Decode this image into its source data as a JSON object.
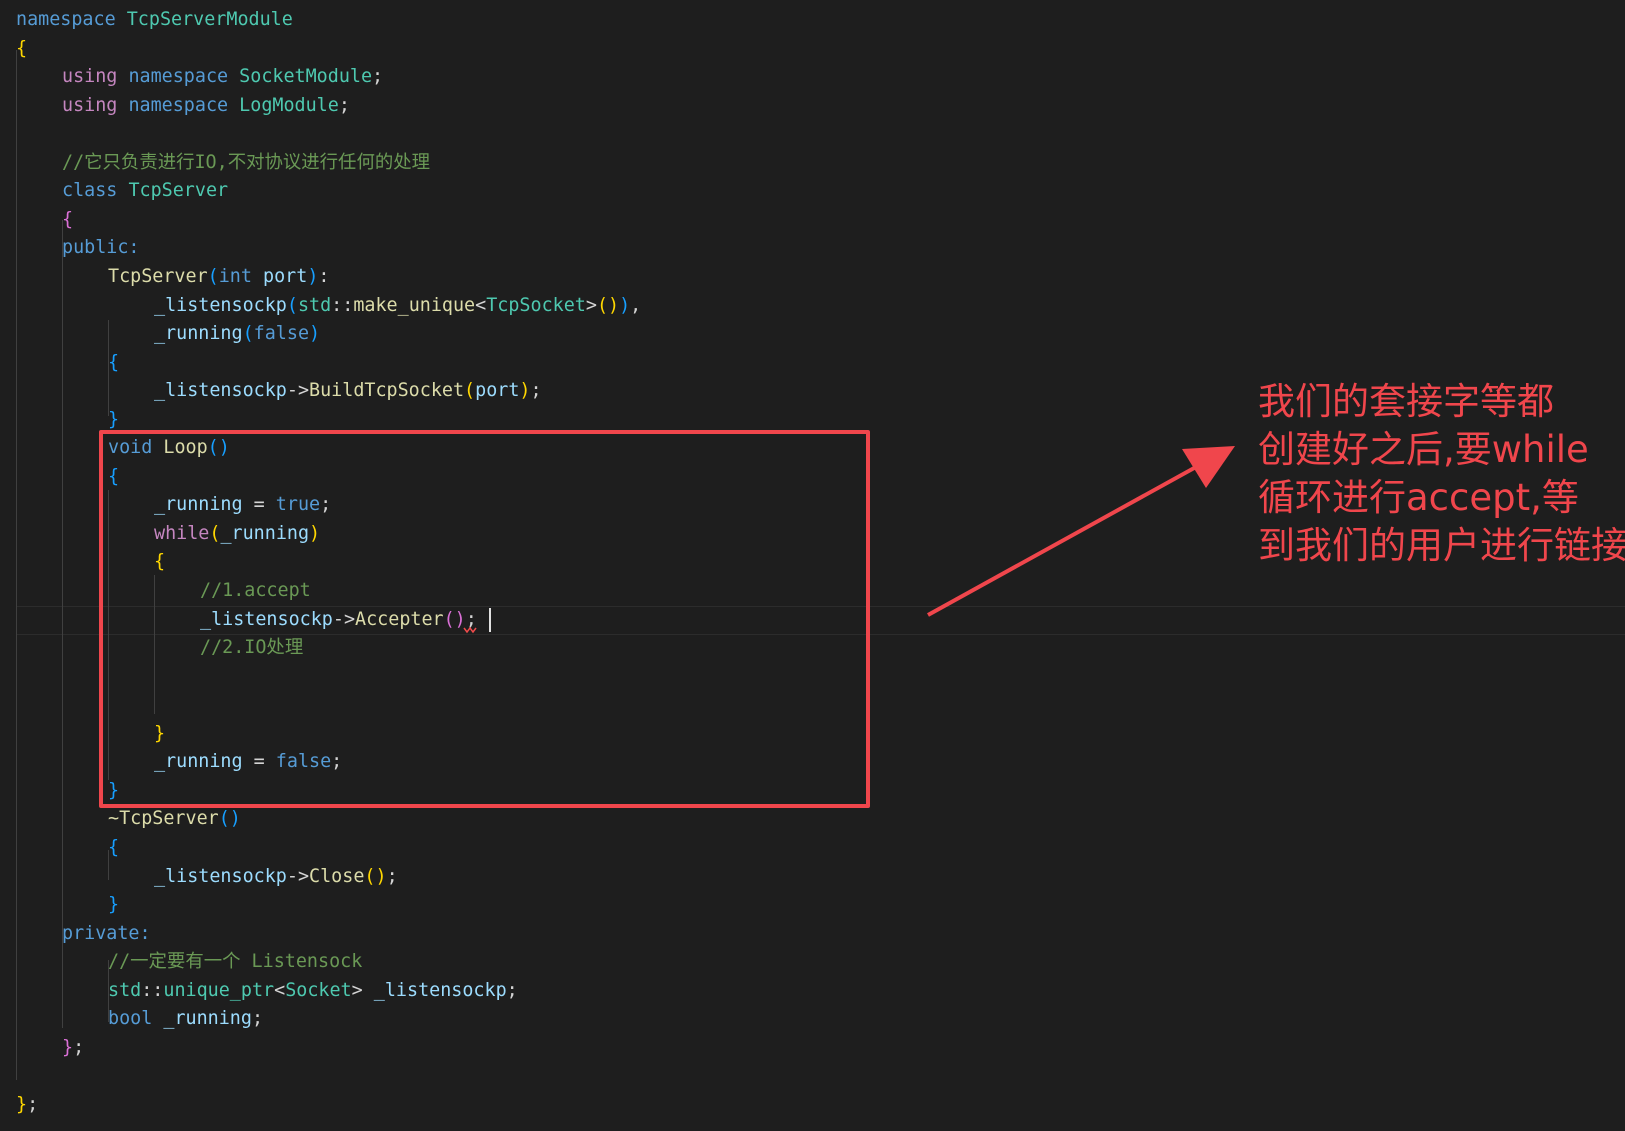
{
  "colors": {
    "background": "#1e1e1e",
    "keyword_blue": "#569cd6",
    "control_pink": "#c586c0",
    "type_teal": "#4ec9b0",
    "function_yellow": "#dcdcaa",
    "variable_lightblue": "#9cdcfe",
    "comment_green": "#6a9955",
    "plain": "#d4d4d4",
    "bracket_gold": "#ffd700",
    "bracket_purple": "#da70d6",
    "bracket_blue": "#179fff",
    "annotation_red": "#f0464c"
  },
  "code_lines": [
    {
      "indent": 0,
      "tokens": [
        [
          "namespace ",
          "#569cd6"
        ],
        [
          "TcpServerModule",
          "#4ec9b0"
        ]
      ]
    },
    {
      "indent": 0,
      "tokens": [
        [
          "{",
          "#ffd700"
        ]
      ]
    },
    {
      "indent": 1,
      "tokens": [
        [
          "using ",
          "#c586c0"
        ],
        [
          "namespace ",
          "#569cd6"
        ],
        [
          "SocketModule",
          "#4ec9b0"
        ],
        [
          ";",
          "#d4d4d4"
        ]
      ]
    },
    {
      "indent": 1,
      "tokens": [
        [
          "using ",
          "#c586c0"
        ],
        [
          "namespace ",
          "#569cd6"
        ],
        [
          "LogModule",
          "#4ec9b0"
        ],
        [
          ";",
          "#d4d4d4"
        ]
      ]
    },
    {
      "indent": 0,
      "tokens": []
    },
    {
      "indent": 1,
      "tokens": [
        [
          "//它只负责进行IO,不对协议进行任何的处理",
          "#6a9955"
        ]
      ]
    },
    {
      "indent": 1,
      "tokens": [
        [
          "class ",
          "#569cd6"
        ],
        [
          "TcpServer",
          "#4ec9b0"
        ]
      ]
    },
    {
      "indent": 1,
      "tokens": [
        [
          "{",
          "#da70d6"
        ]
      ]
    },
    {
      "indent": 1,
      "tokens": [
        [
          "public:",
          "#569cd6"
        ]
      ]
    },
    {
      "indent": 2,
      "tokens": [
        [
          "TcpServer",
          "#dcdcaa"
        ],
        [
          "(",
          "#179fff"
        ],
        [
          "int ",
          "#569cd6"
        ],
        [
          "port",
          "#9cdcfe"
        ],
        [
          ")",
          "#179fff"
        ],
        [
          ":",
          "#d4d4d4"
        ]
      ]
    },
    {
      "indent": 3,
      "tokens": [
        [
          "_listensockp",
          "#9cdcfe"
        ],
        [
          "(",
          "#179fff"
        ],
        [
          "std",
          "#4ec9b0"
        ],
        [
          "::",
          "#d4d4d4"
        ],
        [
          "make_unique",
          "#dcdcaa"
        ],
        [
          "<",
          "#d4d4d4"
        ],
        [
          "TcpSocket",
          "#4ec9b0"
        ],
        [
          ">",
          "#d4d4d4"
        ],
        [
          "()",
          "#ffd700"
        ],
        [
          ")",
          "#179fff"
        ],
        [
          ",",
          "#d4d4d4"
        ]
      ]
    },
    {
      "indent": 3,
      "tokens": [
        [
          "_running",
          "#9cdcfe"
        ],
        [
          "(",
          "#179fff"
        ],
        [
          "false",
          "#569cd6"
        ],
        [
          ")",
          "#179fff"
        ]
      ]
    },
    {
      "indent": 2,
      "tokens": [
        [
          "{",
          "#179fff"
        ]
      ]
    },
    {
      "indent": 3,
      "tokens": [
        [
          "_listensockp",
          "#9cdcfe"
        ],
        [
          "->",
          "#d4d4d4"
        ],
        [
          "BuildTcpSocket",
          "#dcdcaa"
        ],
        [
          "(",
          "#ffd700"
        ],
        [
          "port",
          "#9cdcfe"
        ],
        [
          ")",
          "#ffd700"
        ],
        [
          ";",
          "#d4d4d4"
        ]
      ]
    },
    {
      "indent": 2,
      "tokens": [
        [
          "}",
          "#179fff"
        ]
      ]
    },
    {
      "indent": 2,
      "tokens": [
        [
          "void ",
          "#569cd6"
        ],
        [
          "Loop",
          "#dcdcaa"
        ],
        [
          "()",
          "#179fff"
        ]
      ]
    },
    {
      "indent": 2,
      "tokens": [
        [
          "{",
          "#179fff"
        ]
      ]
    },
    {
      "indent": 3,
      "tokens": [
        [
          "_running",
          "#9cdcfe"
        ],
        [
          " = ",
          "#d4d4d4"
        ],
        [
          "true",
          "#569cd6"
        ],
        [
          ";",
          "#d4d4d4"
        ]
      ]
    },
    {
      "indent": 3,
      "tokens": [
        [
          "while",
          "#c586c0"
        ],
        [
          "(",
          "#ffd700"
        ],
        [
          "_running",
          "#9cdcfe"
        ],
        [
          ")",
          "#ffd700"
        ]
      ]
    },
    {
      "indent": 3,
      "tokens": [
        [
          "{",
          "#ffd700"
        ]
      ]
    },
    {
      "indent": 4,
      "tokens": [
        [
          "//1.accept",
          "#6a9955"
        ]
      ]
    },
    {
      "indent": 4,
      "tokens": [
        [
          "_listensockp",
          "#9cdcfe"
        ],
        [
          "->",
          "#d4d4d4"
        ],
        [
          "Accepter",
          "#dcdcaa"
        ],
        [
          "()",
          "#da70d6"
        ],
        [
          ";",
          "#d4d4d4"
        ]
      ]
    },
    {
      "indent": 4,
      "tokens": [
        [
          "//2.IO处理",
          "#6a9955"
        ]
      ]
    },
    {
      "indent": 0,
      "tokens": []
    },
    {
      "indent": 0,
      "tokens": []
    },
    {
      "indent": 3,
      "tokens": [
        [
          "}",
          "#ffd700"
        ]
      ]
    },
    {
      "indent": 3,
      "tokens": [
        [
          "_running",
          "#9cdcfe"
        ],
        [
          " = ",
          "#d4d4d4"
        ],
        [
          "false",
          "#569cd6"
        ],
        [
          ";",
          "#d4d4d4"
        ]
      ]
    },
    {
      "indent": 2,
      "tokens": [
        [
          "}",
          "#179fff"
        ]
      ]
    },
    {
      "indent": 2,
      "tokens": [
        [
          "~TcpServer",
          "#dcdcaa"
        ],
        [
          "()",
          "#179fff"
        ]
      ]
    },
    {
      "indent": 2,
      "tokens": [
        [
          "{",
          "#179fff"
        ]
      ]
    },
    {
      "indent": 3,
      "tokens": [
        [
          "_listensockp",
          "#9cdcfe"
        ],
        [
          "->",
          "#d4d4d4"
        ],
        [
          "Close",
          "#dcdcaa"
        ],
        [
          "()",
          "#ffd700"
        ],
        [
          ";",
          "#d4d4d4"
        ]
      ]
    },
    {
      "indent": 2,
      "tokens": [
        [
          "}",
          "#179fff"
        ]
      ]
    },
    {
      "indent": 1,
      "tokens": [
        [
          "private:",
          "#569cd6"
        ]
      ]
    },
    {
      "indent": 2,
      "tokens": [
        [
          "//一定要有一个 Listensock",
          "#6a9955"
        ]
      ]
    },
    {
      "indent": 2,
      "tokens": [
        [
          "std",
          "#4ec9b0"
        ],
        [
          "::",
          "#d4d4d4"
        ],
        [
          "unique_ptr",
          "#4ec9b0"
        ],
        [
          "<",
          "#d4d4d4"
        ],
        [
          "Socket",
          "#4ec9b0"
        ],
        [
          "> ",
          "#d4d4d4"
        ],
        [
          "_listensockp",
          "#9cdcfe"
        ],
        [
          ";",
          "#d4d4d4"
        ]
      ]
    },
    {
      "indent": 2,
      "tokens": [
        [
          "bool ",
          "#569cd6"
        ],
        [
          "_running",
          "#9cdcfe"
        ],
        [
          ";",
          "#d4d4d4"
        ]
      ]
    },
    {
      "indent": 1,
      "tokens": [
        [
          "}",
          "#da70d6"
        ],
        [
          ";",
          "#d4d4d4"
        ]
      ]
    },
    {
      "indent": 0,
      "tokens": []
    },
    {
      "indent": 0,
      "tokens": [
        [
          "}",
          "#ffd700"
        ],
        [
          ";",
          "#d4d4d4"
        ]
      ]
    }
  ],
  "annotation": {
    "lines": [
      "我们的套接字等都",
      "创建好之后,要while",
      "循环进行accept,等",
      "到我们的用户进行链接"
    ]
  }
}
